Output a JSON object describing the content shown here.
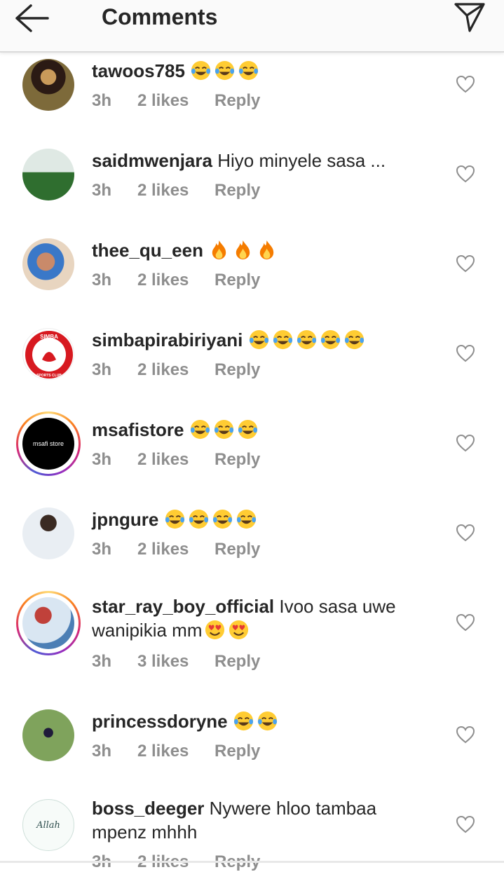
{
  "header": {
    "title": "Comments",
    "back_icon": "arrow-left-icon",
    "send_icon": "paper-plane-icon"
  },
  "comments": [
    {
      "username": "tawoos785",
      "text": "😂😂😂",
      "time": "3h",
      "likes": "2 likes",
      "reply": "Reply",
      "story_ring": false
    },
    {
      "username": "saidmwenjara",
      "text": "Hiyo minyele sasa ...",
      "time": "3h",
      "likes": "2 likes",
      "reply": "Reply",
      "story_ring": false
    },
    {
      "username": "thee_qu_een",
      "text": "🔥🔥🔥",
      "time": "3h",
      "likes": "2 likes",
      "reply": "Reply",
      "story_ring": false
    },
    {
      "username": "simbapirabiriyani",
      "text": "😂😂😂😂😂",
      "time": "3h",
      "likes": "2 likes",
      "reply": "Reply",
      "story_ring": false,
      "avatar_text": "SIMBA SPORTS CLUB"
    },
    {
      "username": "msafistore",
      "text": "😂😂😂",
      "time": "3h",
      "likes": "2 likes",
      "reply": "Reply",
      "story_ring": true,
      "avatar_text": "msafi store"
    },
    {
      "username": "jpngure",
      "text": "😂😂😂😂",
      "time": "3h",
      "likes": "2 likes",
      "reply": "Reply",
      "story_ring": false
    },
    {
      "username": "star_ray_boy_official",
      "text": "Ivoo sasa uwe wanipikia mm😍😍",
      "time": "3h",
      "likes": "3 likes",
      "reply": "Reply",
      "story_ring": true
    },
    {
      "username": "princessdoryne",
      "text": "😂😂",
      "time": "3h",
      "likes": "2 likes",
      "reply": "Reply",
      "story_ring": false
    },
    {
      "username": "boss_deeger",
      "text": "Nywere hloo tambaa mpenz mhhh",
      "time": "3h",
      "likes": "2 likes",
      "reply": "Reply",
      "story_ring": false,
      "avatar_text": "Allah"
    }
  ],
  "colors": {
    "text": "#262626",
    "meta": "#8e8e8e",
    "header_bg": "#fafafa",
    "story_ring": [
      "#feda75",
      "#fa7e1e",
      "#d62976",
      "#962fbf"
    ]
  }
}
